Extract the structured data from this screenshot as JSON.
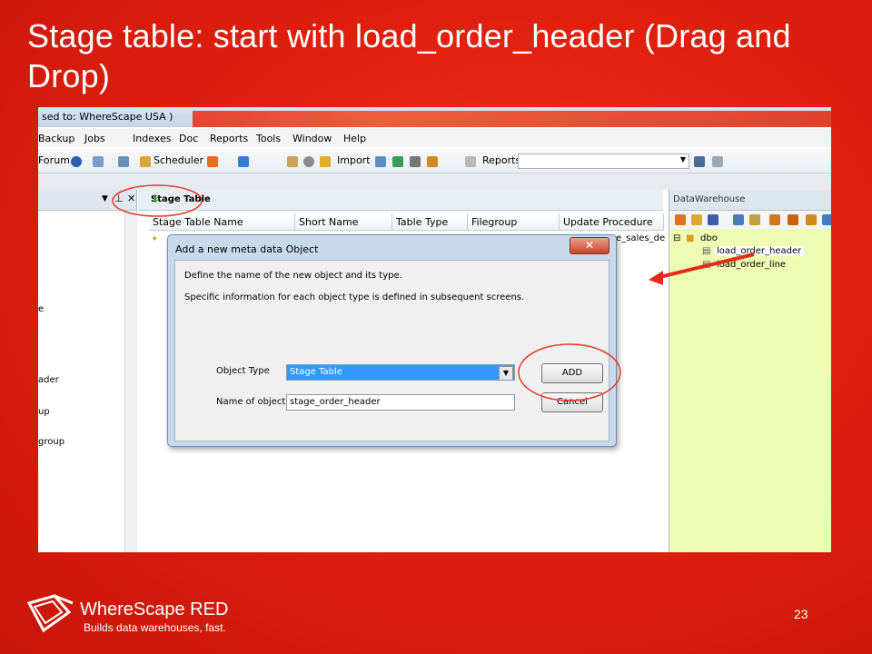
{
  "slide": {
    "title": "Stage table: start with load_order_header  (Drag and Drop)",
    "page_number": "23"
  },
  "app": {
    "title_fragment": "sed to: WhereScape USA )",
    "menu": [
      "Backup",
      "Jobs",
      "Indexes",
      "Doc",
      "Reports",
      "Tools",
      "Window",
      "Help"
    ],
    "toolbar": {
      "forum": "Forum",
      "scheduler": "Scheduler",
      "import": "Import",
      "reports_dropdown": "Reports"
    },
    "left_pane_fragments": [
      "e",
      "ader",
      "up",
      "group"
    ],
    "center": {
      "tab_label": "Stage Table",
      "columns": [
        "Stage Table Name",
        "Short Name",
        "Table Type",
        "Filegroup",
        "Update Procedure"
      ],
      "row_tail": "e_sales_de"
    },
    "right_pane": {
      "title": "DataWarehouse",
      "tree": {
        "root": "dbo",
        "items": [
          "load_order_header",
          "load_order_line"
        ]
      }
    }
  },
  "dialog": {
    "title": "Add a new meta data Object",
    "close": "✕",
    "line1": "Define the name of the new object and its type.",
    "line2": "Specific information for each object type is defined in subsequent screens.",
    "object_type_label": "Object Type",
    "object_type_value": "Stage Table",
    "name_label": "Name of object",
    "name_value": "stage_order_header",
    "add_button": "ADD",
    "cancel_button": "Cancel"
  },
  "footer": {
    "brand": "WhereScape RED",
    "tagline": "Builds data warehouses, fast."
  },
  "colors": {
    "slide_red": "#e0200f",
    "highlight_circle": "#e53a2a",
    "datawarehouse_bg": "#eefbb3",
    "selection_blue": "#3399ff"
  }
}
